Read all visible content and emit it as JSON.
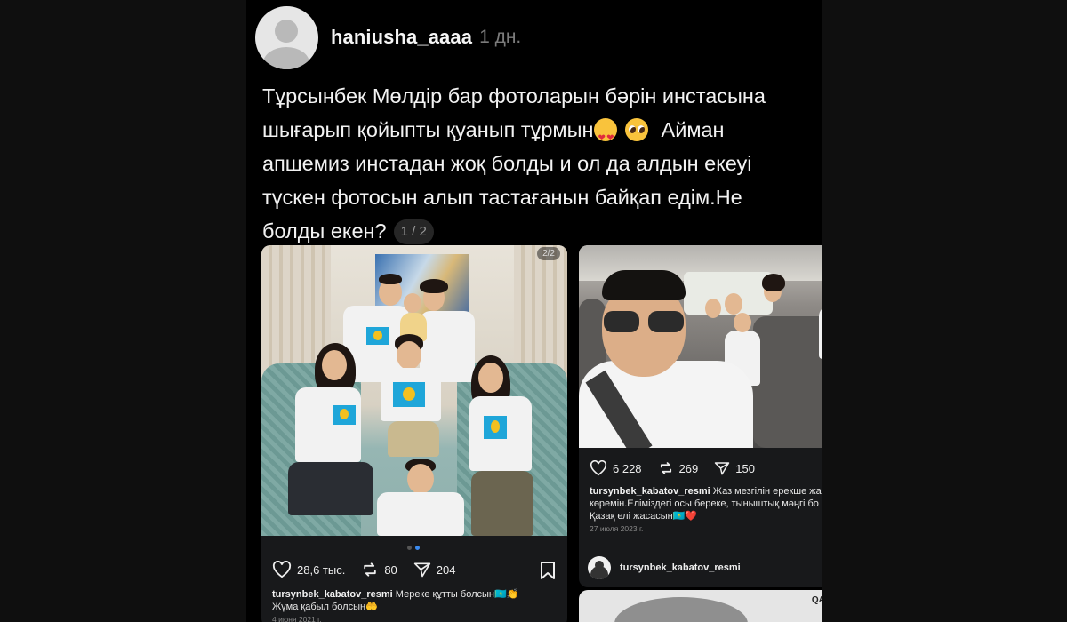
{
  "post": {
    "username": "haniusha_aaaa",
    "time": "1 дн.",
    "text_line1": "Тұрсынбек Мөлдір бар фотоларын бәрін инстасына",
    "text_line2": "шығарып қойыпты қуанып тұрмын",
    "text_line2b": "Айман",
    "text_line3": "апшемиз инстадан жоқ болды и ол да алдын екеуі",
    "text_line4": "түскен фотосын алып тастағанын байқап едім.Не",
    "text_line5": "болды екен?",
    "page_indicator": "1 / 2",
    "emojis": [
      "heart-eyes-emoji",
      "pleading-face-emoji"
    ]
  },
  "card1": {
    "image_counter": "2/2",
    "likes": "28,6 тыс.",
    "reposts": "80",
    "shares": "204",
    "caption_user": "tursynbek_kabatov_resmi",
    "caption_text_1": "Мереке құтты болсын🇰🇿👏",
    "caption_text_2": "Жұма қабыл болсын🤲",
    "date": "4 июня 2021 г."
  },
  "card2": {
    "likes": "6 228",
    "reposts": "269",
    "shares": "150",
    "caption_user": "tursynbek_kabatov_resmi",
    "caption_text_1": "Жаз мезгілін ерекше жа",
    "caption_text_2": "көремін.Еліміздегі осы береке, тыныштық мәңгі бо",
    "caption_text_3": "Қазақ елі жасасын🇰🇿❤️",
    "date": "27 июля 2023 г.",
    "author": "tursynbek_kabatov_resmi"
  },
  "card3": {
    "label": "QAZAQ"
  },
  "colors": {
    "background": "#000000",
    "card": "#18191b",
    "muted": "#7b7b7b",
    "carousel_active": "#3b8bf0"
  }
}
